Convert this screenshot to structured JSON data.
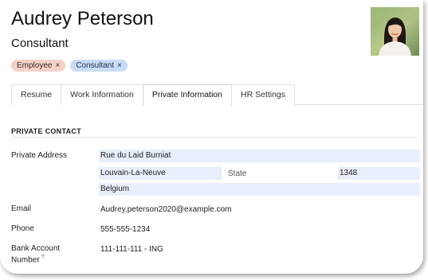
{
  "header": {
    "name": "Audrey Peterson",
    "job_title": "Consultant",
    "tags": [
      {
        "label": "Employee",
        "remove": "×"
      },
      {
        "label": "Consultant",
        "remove": "×"
      }
    ]
  },
  "tabs": [
    {
      "label": "Resume",
      "active": false
    },
    {
      "label": "Work Information",
      "active": false
    },
    {
      "label": "Private Information",
      "active": true
    },
    {
      "label": "HR Settings",
      "active": false
    }
  ],
  "private_contact": {
    "section_title": "PRIVATE CONTACT",
    "address_label": "Private Address",
    "street": "Rue du Laid Burniat",
    "city": "Louvain-La-Neuve",
    "state_label": "State",
    "state_value": "",
    "zip": "1348",
    "country": "Belgium",
    "email_label": "Email",
    "email": "Audrey.peterson2020@example.com",
    "phone_label": "Phone",
    "phone": "555-555-1234",
    "bank_label_1": "Bank Account",
    "bank_label_2": "Number",
    "bank_help": "?",
    "bank": "111-111-111 - ING"
  },
  "colors": {
    "tag_employee": "#f4d2c8",
    "tag_consultant": "#c9dcf5",
    "field_bg": "#e8eefa"
  }
}
